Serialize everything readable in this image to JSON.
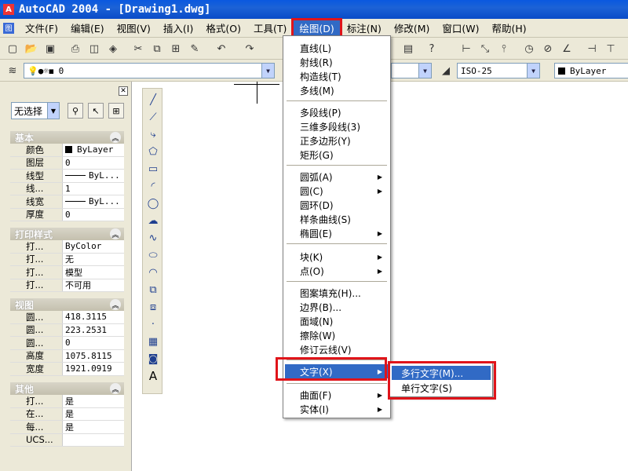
{
  "window": {
    "title": "AutoCAD 2004 - [Drawing1.dwg]",
    "logo_glyph": "A"
  },
  "menubar": {
    "doc_icon": "图",
    "items": [
      "文件(F)",
      "编辑(E)",
      "视图(V)",
      "插入(I)",
      "格式(O)",
      "工具(T)",
      "绘图(D)",
      "标注(N)",
      "修改(M)",
      "窗口(W)",
      "帮助(H)"
    ]
  },
  "toolbar2": {
    "layer_value": "0",
    "dim_style": "ISO-25",
    "color_value": "ByLayer"
  },
  "properties": {
    "selection": "无选择",
    "sections": {
      "basic": {
        "title": "基本",
        "rows": [
          {
            "k": "颜色",
            "v": "ByLayer"
          },
          {
            "k": "图层",
            "v": "0"
          },
          {
            "k": "线型",
            "v": "ByL..."
          },
          {
            "k": "线...",
            "v": "1"
          },
          {
            "k": "线宽",
            "v": "ByL..."
          },
          {
            "k": "厚度",
            "v": "0"
          }
        ]
      },
      "print": {
        "title": "打印样式",
        "rows": [
          {
            "k": "打...",
            "v": "ByColor"
          },
          {
            "k": "打...",
            "v": "无"
          },
          {
            "k": "打...",
            "v": "模型"
          },
          {
            "k": "打...",
            "v": "不可用"
          }
        ]
      },
      "view": {
        "title": "视图",
        "rows": [
          {
            "k": "圆...",
            "v": "418.3115"
          },
          {
            "k": "圆...",
            "v": "223.2531"
          },
          {
            "k": "圆...",
            "v": "0"
          },
          {
            "k": "高度",
            "v": "1075.8115"
          },
          {
            "k": "宽度",
            "v": "1921.0919"
          }
        ]
      },
      "other": {
        "title": "其他",
        "rows": [
          {
            "k": "打...",
            "v": "是"
          },
          {
            "k": "在...",
            "v": "是"
          },
          {
            "k": "每...",
            "v": "是"
          },
          {
            "k": "UCS...",
            "v": ""
          }
        ]
      }
    }
  },
  "draw_menu": {
    "items": [
      {
        "label": "直线(L)"
      },
      {
        "label": "射线(R)"
      },
      {
        "label": "构造线(T)"
      },
      {
        "label": "多线(M)"
      },
      {
        "label": "多段线(P)"
      },
      {
        "label": "三维多段线(3)"
      },
      {
        "label": "正多边形(Y)"
      },
      {
        "label": "矩形(G)"
      },
      {
        "label": "圆弧(A)"
      },
      {
        "label": "圆(C)"
      },
      {
        "label": "圆环(D)"
      },
      {
        "label": "样条曲线(S)"
      },
      {
        "label": "椭圆(E)"
      },
      {
        "label": "块(K)"
      },
      {
        "label": "点(O)"
      },
      {
        "label": "图案填充(H)..."
      },
      {
        "label": "边界(B)..."
      },
      {
        "label": "面域(N)"
      },
      {
        "label": "擦除(W)"
      },
      {
        "label": "修订云线(V)"
      },
      {
        "label": "文字(X)"
      },
      {
        "label": "曲面(F)"
      },
      {
        "label": "实体(I)"
      }
    ]
  },
  "text_submenu": {
    "items": [
      "多行文字(M)...",
      "单行文字(S)"
    ]
  },
  "draw_toolbar_last_label": "A",
  "colors": {
    "highlight": "#316AC5",
    "annotation_red": "#E0141A",
    "chrome": "#ECE9D8",
    "titlebar": "#0A58E0"
  }
}
